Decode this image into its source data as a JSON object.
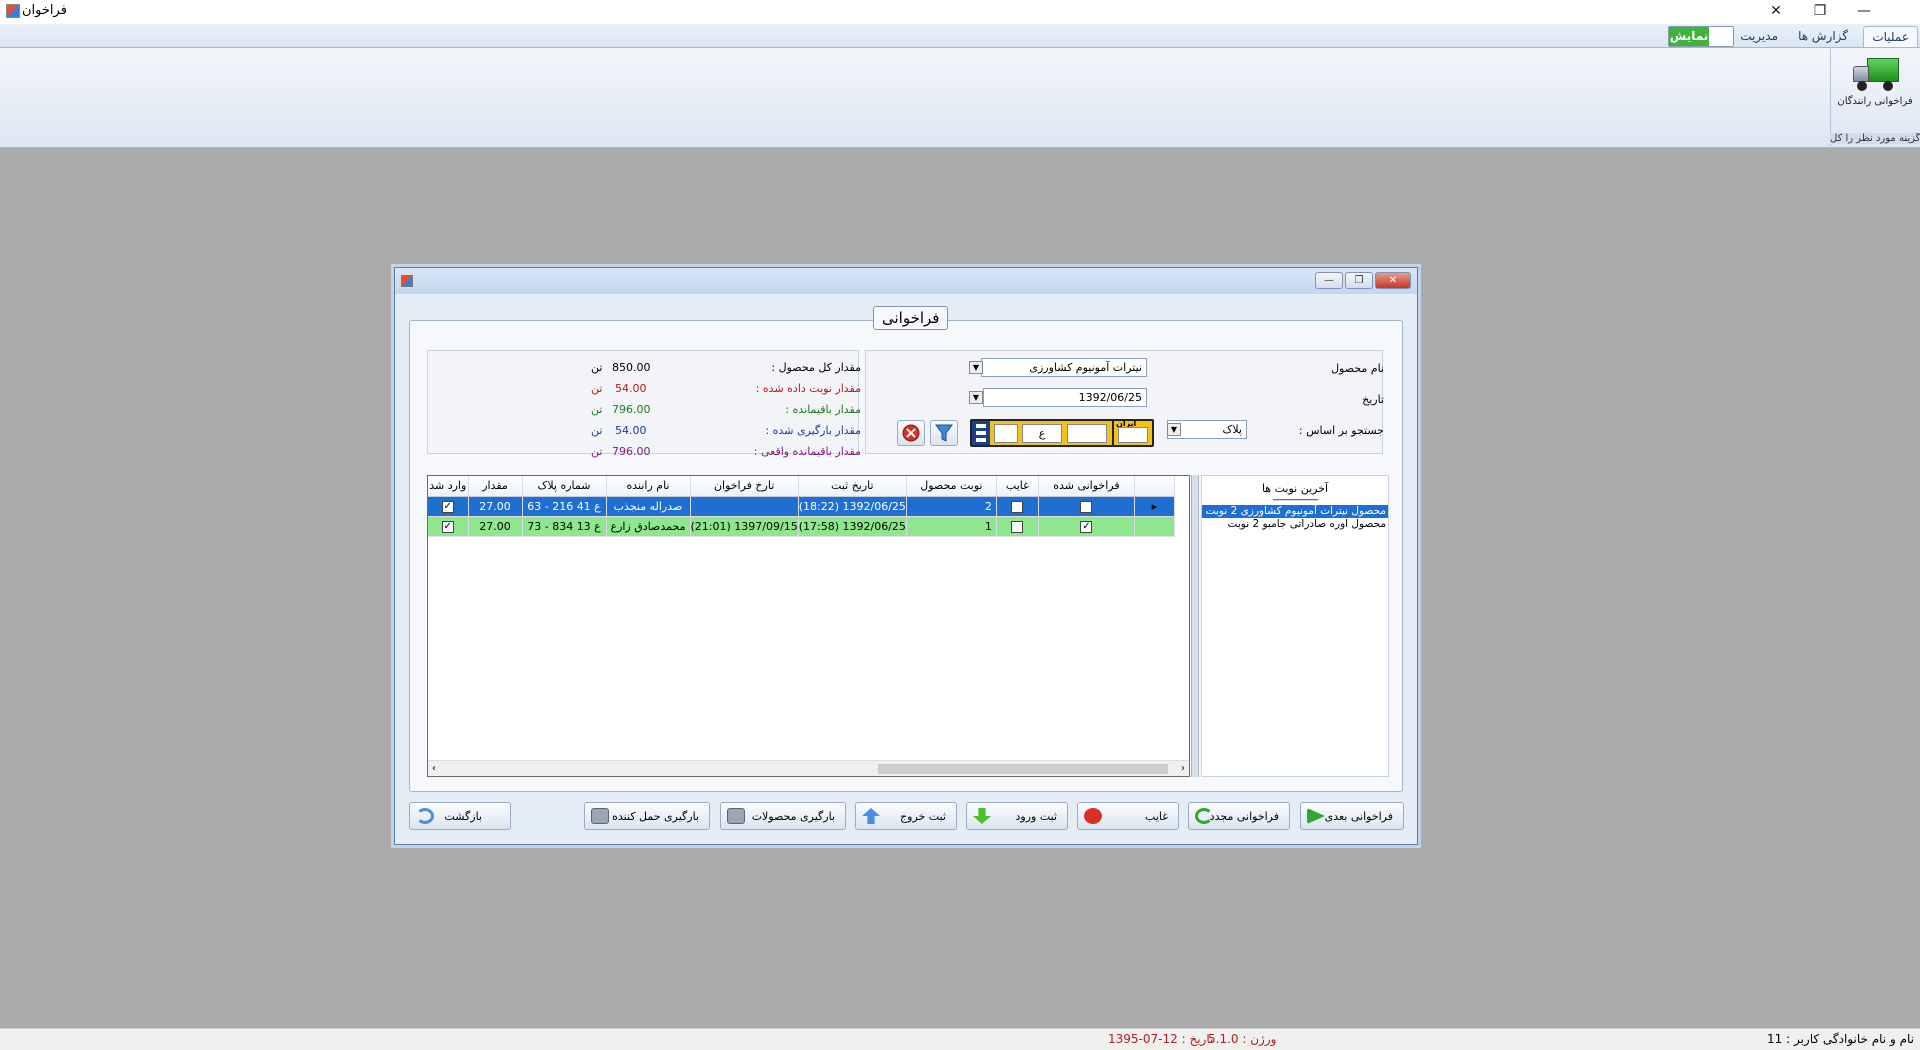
{
  "window": {
    "title": "فراخوان",
    "controls": [
      "—",
      "❐",
      "✕"
    ]
  },
  "ribbon": {
    "tabs": [
      {
        "label": "عملیات",
        "active": true
      },
      {
        "label": "گزارش ها",
        "active": false
      },
      {
        "label": "مدیریت",
        "active": false
      }
    ],
    "show_toggle": "نمایش",
    "truck_button_label": "فراخوانی رانندگان",
    "group_caption": "گزینه مورد نظر را کل..."
  },
  "dialog": {
    "frame_title": "فراخوانی",
    "product_label": "نام محصول",
    "product_value": "نیترات آمونیوم کشاورزی",
    "date_label": "تاریخ",
    "date_value": "1392/06/25",
    "search_label": "جستجو بر اساس :",
    "search_value": "پلاک",
    "plate": {
      "letter": "ع",
      "region_label": "ایران"
    },
    "stats": [
      {
        "label": "مقدار کل  محصول :",
        "value": "850.00",
        "unit": "تن",
        "color": "#000000"
      },
      {
        "label": "مقدار نوبت داده شده :",
        "value": "54.00",
        "unit": "تن",
        "color": "#b01e1e"
      },
      {
        "label": "مقدار باقیمانده :",
        "value": "796.00",
        "unit": "تن",
        "color": "#1e7a1e"
      },
      {
        "label": "مقدار بارگیری شده :",
        "value": "54.00",
        "unit": "تن",
        "color": "#1e3aa8"
      },
      {
        "label": "مقدار باقیمانده واقعی :",
        "value": "796.00",
        "unit": "تن",
        "color": "#7a1e7a"
      }
    ],
    "grid": {
      "columns": [
        "فراخوانی شده",
        "غایب",
        "نوبت محصول",
        "تاریخ ثبت",
        "تارخ فراخوان",
        "نام راننده",
        "شماره پلاک",
        "مقدار",
        "وارد شد"
      ],
      "rows": [
        {
          "called": false,
          "absent": false,
          "turn": "2",
          "reg_date": "1392/06/25 (18:22)",
          "call_date": "",
          "driver": "صدراله منجذب",
          "plate": "63 - 216 ع 41",
          "amount": "27.00",
          "entered": true
        },
        {
          "called": true,
          "absent": false,
          "turn": "1",
          "reg_date": "1392/06/25 (17:58)",
          "call_date": "1397/09/15 (21:01)",
          "driver": "محمدصادق زارع",
          "plate": "73 - 834 ع 13",
          "amount": "27.00",
          "entered": true
        }
      ]
    },
    "last_queue": {
      "title": "آخرین نوبت ها",
      "divider": "--------------------",
      "items": [
        "محصول نیترات آمونیوم کشاورزی 2 نوبت",
        "محصول اوره  صادراتی  جامبو 2 نوبت"
      ]
    },
    "buttons": {
      "next": "فراخوانی بعدی",
      "recall": "فراخوانی مجدد",
      "absent": "غایب",
      "entry": "ثبت ورود",
      "exit": "ثبت خروج",
      "load_products": "بارگیری محصولات",
      "load_carrier": "بارگیری حمل کننده",
      "back": "بازگشت"
    }
  },
  "status": {
    "user": "نام و نام خانوادگی کاربر : 11",
    "version": "ورژن : 5.1.0",
    "date": "تاریخ : 12-07-1395"
  },
  "colors": {
    "accent": "#1f6fd1",
    "row_green": "#8ee68e",
    "status_red": "#b01e1e"
  }
}
